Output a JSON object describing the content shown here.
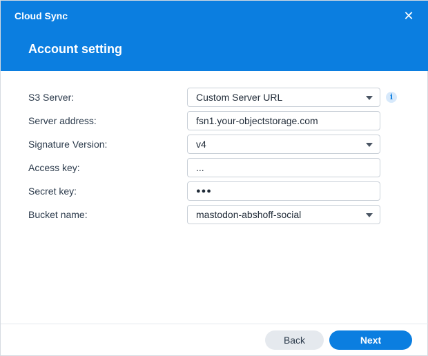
{
  "window": {
    "app_title": "Cloud Sync",
    "close_icon": "close-icon"
  },
  "page": {
    "title": "Account setting"
  },
  "form": {
    "s3_server": {
      "label": "S3 Server:",
      "value": "Custom Server URL"
    },
    "server_address": {
      "label": "Server address:",
      "value": "fsn1.your-objectstorage.com"
    },
    "signature_version": {
      "label": "Signature Version:",
      "value": "v4"
    },
    "access_key": {
      "label": "Access key:",
      "value": "..."
    },
    "secret_key": {
      "label": "Secret key:",
      "value": "●●●"
    },
    "bucket_name": {
      "label": "Bucket name:",
      "value": "mastodon-abshoff-social"
    },
    "info_icon_glyph": "i"
  },
  "footer": {
    "back_label": "Back",
    "next_label": "Next"
  },
  "colors": {
    "header_bg": "#0b7ee0",
    "primary_button": "#0b7ee0",
    "secondary_button": "#e5e9ee"
  }
}
